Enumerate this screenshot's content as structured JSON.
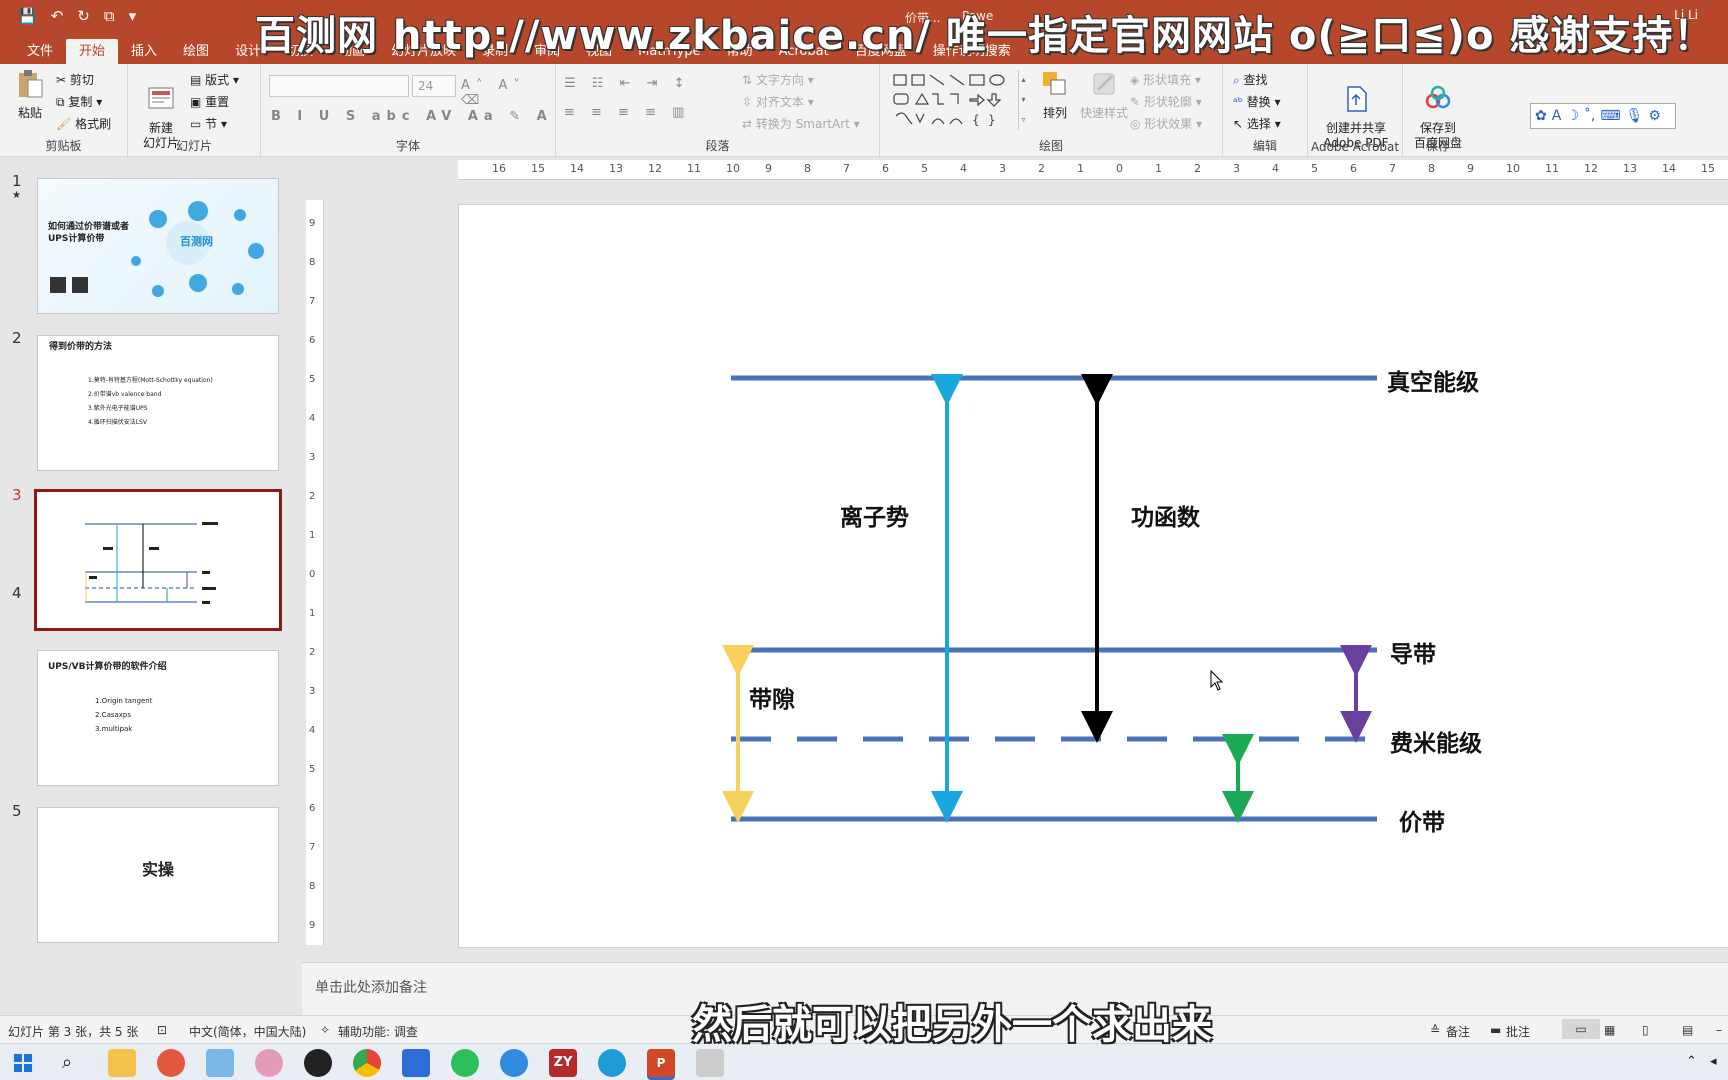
{
  "window": {
    "doc_title": "价带...",
    "app_name": "Powe",
    "user": "Li Li"
  },
  "watermark": "百测网 http://www.zkbaice.cn/ 唯一指定官网网站 o(≧口≦)o 感谢支持！",
  "tabs": [
    "文件",
    "开始",
    "插入",
    "绘图",
    "设计",
    "切换",
    "动画",
    "幻灯片放映",
    "录制",
    "审阅",
    "视图",
    "MathType",
    "帮助",
    "Acrobat",
    "百度网盘",
    "操作说明搜索"
  ],
  "active_tab": "开始",
  "ribbon": {
    "clipboard": {
      "label": "剪贴板",
      "paste": "粘贴",
      "cut": "剪切",
      "copy": "复制",
      "format_painter": "格式刷"
    },
    "slides": {
      "label": "幻灯片",
      "new_slide": "新建\n幻灯片",
      "layout": "版式",
      "reset": "重置",
      "section": "节"
    },
    "font": {
      "label": "字体",
      "size": "24"
    },
    "paragraph": {
      "label": "段落",
      "text_direction": "文字方向",
      "align_text": "对齐文本",
      "smartart": "转换为 SmartArt"
    },
    "drawing": {
      "label": "绘图",
      "arrange": "排列",
      "quick_styles": "快速样式",
      "fill": "形状填充",
      "outline": "形状轮廓",
      "effects": "形状效果"
    },
    "editing": {
      "label": "编辑",
      "find": "查找",
      "replace": "替换",
      "select": "选择"
    },
    "acrobat": {
      "label": "Adobe Acrobat",
      "create": "创建并共享\nAdobe PDF"
    },
    "save": {
      "label": "保存",
      "baidu": "保存到\n百度网盘"
    }
  },
  "ruler_h_labels": [
    "16",
    "15",
    "14",
    "13",
    "12",
    "11",
    "10",
    "9",
    "8",
    "7",
    "6",
    "5",
    "4",
    "3",
    "2",
    "1",
    "0",
    "1",
    "2",
    "3",
    "4",
    "5",
    "6",
    "7",
    "8",
    "9",
    "10",
    "11",
    "12",
    "13",
    "14",
    "15"
  ],
  "ruler_v_labels": [
    "9",
    "8",
    "7",
    "6",
    "5",
    "4",
    "3",
    "2",
    "1",
    "0",
    "1",
    "2",
    "3",
    "4",
    "5",
    "6",
    "7",
    "8",
    "9"
  ],
  "thumbnails": [
    {
      "num": "1",
      "star": "★",
      "title": "如何通过价带谱或者\nUPS计算价带",
      "sub": "百测网"
    },
    {
      "num": "2",
      "title": "得到价带的方法",
      "lines": [
        "1.莫特-肖特基方程(Mott-Schottky equation)",
        "2.价带谱vb valence band",
        "3.紫外光电子能谱UPS",
        "4.循环扫描伏安法LSV"
      ]
    },
    {
      "num": "3"
    },
    {
      "num": "4",
      "title": "UPS/VB计算价带的软件介绍",
      "lines": [
        "1.Origin  tangent",
        "2.Casaxps",
        "3.multipak"
      ]
    },
    {
      "num": "5",
      "title": "实操"
    }
  ],
  "selected_slide": 3,
  "slide": {
    "vacuum_level": "真空能级",
    "conduction_band": "导带",
    "fermi_level": "费米能级",
    "valence_band": "价带",
    "ionization_potential": "离子势",
    "work_function": "功函数",
    "band_gap": "带隙",
    "colors": {
      "line": "#4a72b8",
      "ion": "#19a7e0",
      "work": "#000000",
      "gap": "#f7d15e",
      "purple": "#6b3fa0",
      "green": "#1aaa55"
    }
  },
  "notes_placeholder": "单击此处添加备注",
  "status": {
    "slide_info": "幻灯片 第 3 张，共 5 张",
    "language": "中文(简体，中国大陆)",
    "accessibility": "辅助功能: 调查",
    "notes": "备注",
    "comments": "批注"
  },
  "subtitle": "然后就可以把另外一个求出来"
}
